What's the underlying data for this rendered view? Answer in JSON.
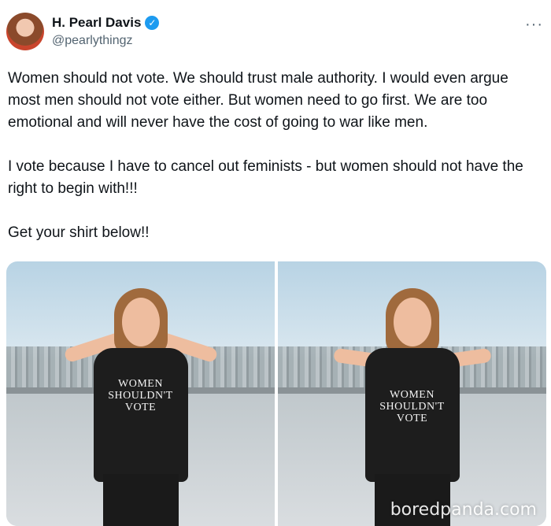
{
  "author": {
    "name": "H. Pearl Davis",
    "handle": "@pearlythingz",
    "verified_icon": "verified-badge-icon",
    "more_icon": "more-icon",
    "more_glyph": "···"
  },
  "tweet": {
    "paragraphs": [
      "Women should not vote. We should trust male authority. I would even argue most men should not vote either. But women need to go first. We are too emotional and will never have the cost of going to war like men.",
      "I vote because I have to cancel out feminists - but women should not have the right to begin with!!!",
      "Get your shirt below!!"
    ]
  },
  "media": {
    "shirt_lines": [
      "WOMEN",
      "SHOULDN'T",
      "VOTE"
    ],
    "watermark": "boredpanda.com"
  },
  "colors": {
    "verified": "#1d9bf0",
    "text": "#0f1419",
    "secondary": "#536471"
  }
}
